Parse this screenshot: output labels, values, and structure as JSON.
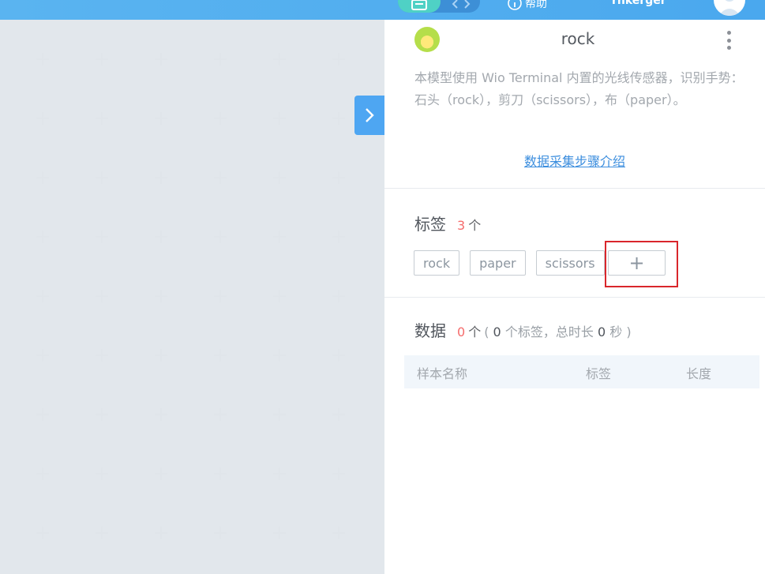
{
  "header": {
    "mode_toggle": {
      "active": "data-mode",
      "icons": [
        "book-icon",
        "code-icon"
      ]
    },
    "help_label": "帮助",
    "username": "rnkerger"
  },
  "model": {
    "name": "rock",
    "description": "本模型使用 Wio Terminal 内置的光线传感器，识别手势：石头（rock），剪刀（scissors），布（paper）。",
    "guide_link": "数据采集步骤介绍"
  },
  "labels_section": {
    "title": "标签",
    "count": "3",
    "unit": "个",
    "tags": [
      "rock",
      "paper",
      "scissors"
    ],
    "add_symbol": "+"
  },
  "data_section": {
    "title": "数据",
    "count": "0",
    "unit": "个",
    "meta_open": "(",
    "label_count": "0",
    "label_unit": "个标签，总时长",
    "duration": "0",
    "duration_unit": "秒",
    "meta_close": ")",
    "columns": [
      "样本名称",
      "标签",
      "长度"
    ]
  },
  "colors": {
    "accent": "#4ea6f2",
    "count_red": "#f56c6c",
    "highlight_red": "#d9262b"
  }
}
